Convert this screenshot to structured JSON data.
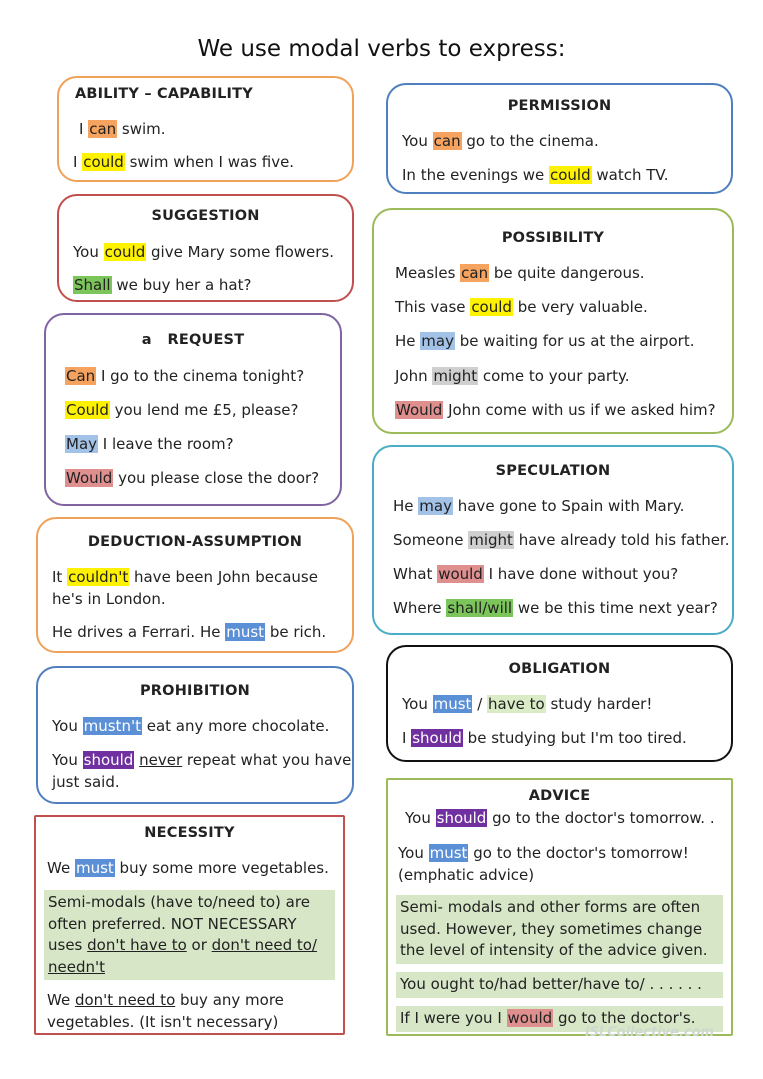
{
  "title": "We use modal verbs to express:",
  "colors": {
    "ability_border": "#f0a15a",
    "permission_border": "#4f7fbf",
    "suggestion_border": "#c0504d",
    "possibility_border": "#9bbb59",
    "request_border": "#8064a2",
    "speculation_border": "#4bacc6",
    "deduction_border": "#f0a15a",
    "obligation_border": "#111111",
    "prohibition_border": "#4f7fbf",
    "necessity_border": "#c0504d",
    "advice_border": "#9bbb59"
  },
  "ability": {
    "heading": "ABILITY – CAPABILITY",
    "l1": [
      "I ",
      "can",
      " swim."
    ],
    "l2": [
      "I ",
      "could",
      " swim when I was five."
    ]
  },
  "permission": {
    "heading": "PERMISSION",
    "l1": [
      "You ",
      "can",
      " go to the cinema."
    ],
    "l2": [
      "In the evenings we ",
      "could",
      " watch TV."
    ]
  },
  "suggestion": {
    "heading": "SUGGESTION",
    "l1": [
      "You ",
      "could",
      " give Mary some flowers."
    ],
    "l2": [
      "Shall",
      " we buy her a hat?"
    ]
  },
  "possibility": {
    "heading": "POSSIBILITY",
    "l1": [
      "Measles ",
      "can",
      " be quite dangerous."
    ],
    "l2": [
      "This vase ",
      "could",
      " be very valuable."
    ],
    "l3": [
      "He ",
      "may",
      " be waiting for us at the airport."
    ],
    "l4": [
      "John ",
      "might",
      " come to your party."
    ],
    "l5": [
      "Would",
      " John come with us if we asked him?"
    ]
  },
  "request": {
    "heading_a": "a",
    "heading": "REQUEST",
    "l1": [
      "Can",
      " I go to the cinema tonight?"
    ],
    "l2": [
      "Could",
      " you lend me £5, please?"
    ],
    "l3": [
      "May",
      " I leave the room?"
    ],
    "l4": [
      "Would",
      " you please close the door?"
    ]
  },
  "speculation": {
    "heading": "SPECULATION",
    "l1": [
      "He ",
      "may",
      " have gone to Spain with Mary."
    ],
    "l2": [
      "Someone ",
      "might",
      " have already told his father."
    ],
    "l3": [
      "What ",
      "would",
      " I have done without you?"
    ],
    "l4": [
      "Where ",
      "shall/will",
      " we be this time next year?"
    ]
  },
  "deduction": {
    "heading": "DEDUCTION-ASSUMPTION",
    "l1": [
      "It ",
      "couldn't",
      " have been John because"
    ],
    "l1b": "he's in London.",
    "l2": [
      "He drives a Ferrari.  He ",
      "must",
      " be rich."
    ]
  },
  "obligation": {
    "heading": "OBLIGATION",
    "l1": [
      "You ",
      "must",
      " / ",
      "have to",
      " study harder!"
    ],
    "l2": [
      "I ",
      "should",
      " be studying but I'm too tired."
    ]
  },
  "prohibition": {
    "heading": "PROHIBITION",
    "l1": [
      "You ",
      "mustn't",
      " eat any more chocolate."
    ],
    "l2": [
      "You ",
      "should",
      " ",
      "never",
      " repeat what you have"
    ],
    "l2b": "just said."
  },
  "necessity": {
    "heading": "NECESSITY",
    "l1": [
      "We ",
      "must",
      " buy some more vegetables."
    ],
    "panel": [
      "Semi-modals (have to/need to) are often preferred.  NOT NECESSARY uses ",
      "don't have to",
      " or ",
      "don't need to/ needn't"
    ],
    "l3": [
      "We ",
      "don't need to",
      " buy any more"
    ],
    "l3b": "vegetables. (It isn't necessary)"
  },
  "advice": {
    "heading": "ADVICE",
    "l1": [
      "You ",
      "should",
      " go to the doctor's tomorrow.     ."
    ],
    "l2": [
      "You ",
      "must",
      " go to the doctor's tomorrow!"
    ],
    "l2b": "(emphatic advice)",
    "panel1": "Semi- modals and other forms are often used.  However, they sometimes change the level of intensity of the advice given.",
    "panel2": "You ought to/had better/have to/ . . . . . .",
    "panel3": [
      "If I were you  I ",
      "would",
      " go to the doctor's."
    ]
  },
  "watermark": "iSLCollective.com"
}
